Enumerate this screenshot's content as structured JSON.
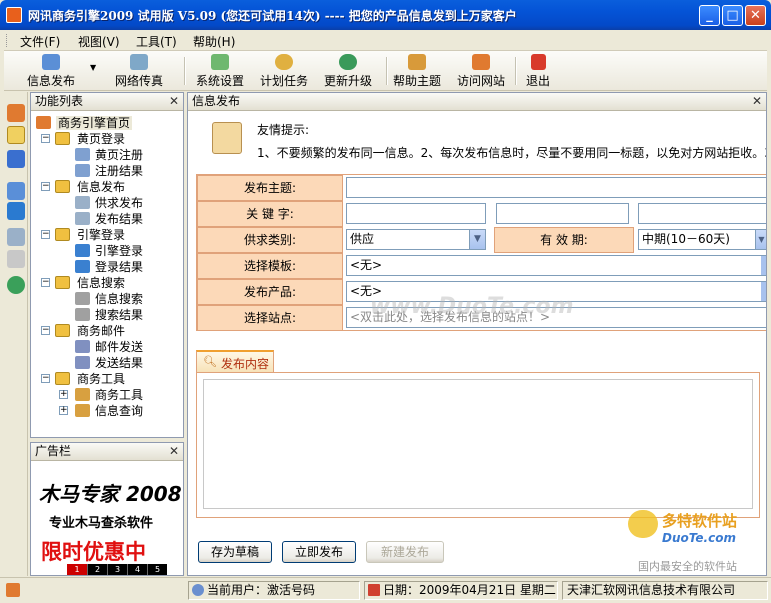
{
  "window": {
    "title": "网讯商务引擎2009 试用版 V5.09 (您还可试用14次) ---- 把您的产品信息发到上万家客户",
    "colors": {
      "titlebar": "#0453d6",
      "form_label_bg": "#fcd9b8",
      "form_border": "#e0a27a",
      "accent": "#e8601c"
    }
  },
  "menu": [
    "文件(F)",
    "视图(V)",
    "工具(T)",
    "帮助(H)"
  ],
  "toolbar": [
    {
      "label": "信息发布",
      "icon": "publish-icon"
    },
    {
      "label": "网络传真",
      "icon": "fax-icon"
    },
    {
      "label": "系统设置",
      "icon": "settings-icon"
    },
    {
      "label": "计划任务",
      "icon": "clock-icon"
    },
    {
      "label": "更新升级",
      "icon": "update-icon"
    },
    {
      "label": "帮助主题",
      "icon": "help-book-icon"
    },
    {
      "label": "访问网站",
      "icon": "home-icon"
    },
    {
      "label": "退出",
      "icon": "exit-icon"
    }
  ],
  "function_panel": {
    "title": "功能列表",
    "root": "商务引擎首页",
    "groups": [
      {
        "label": "黄页登录",
        "items": [
          "黄页注册",
          "注册结果"
        ]
      },
      {
        "label": "信息发布",
        "items": [
          "供求发布",
          "发布结果"
        ]
      },
      {
        "label": "引擎登录",
        "items": [
          "引擎登录",
          "登录结果"
        ]
      },
      {
        "label": "信息搜索",
        "items": [
          "信息搜索",
          "搜索结果"
        ]
      },
      {
        "label": "商务邮件",
        "items": [
          "邮件发送",
          "发送结果"
        ]
      },
      {
        "label": "商务工具",
        "items": [
          "商务工具",
          "信息查询"
        ]
      }
    ]
  },
  "ad_panel": {
    "title": "广告栏",
    "brand": "木马专家 2008",
    "slogan": "专业木马查杀软件",
    "promo": "限时优惠中",
    "pages": [
      "1",
      "2",
      "3",
      "4",
      "5"
    ]
  },
  "main": {
    "title": "信息发布",
    "tip_title": "友情提示:",
    "tip_text": "1、不要频繁的发布同一信息。2、每次发布信息时，尽量不要用同一标题，以免对方网站拒收。3",
    "form": {
      "subject_label": "发布主题:",
      "subject_value": "",
      "keyword_label": "关 键 字:",
      "keywords": [
        "",
        "",
        ""
      ],
      "category_label": "供求类别:",
      "category_value": "供应",
      "validity_label": "有 效 期:",
      "validity_value": "中期(10－60天)",
      "template_label": "选择模板:",
      "template_value": "<无>",
      "product_label": "发布产品:",
      "product_value": "<无>",
      "site_label": "选择站点:",
      "site_placeholder": "<双击此处，选择发布信息的站点！>"
    },
    "content_tab": "发布内容",
    "content_value": "",
    "buttons": {
      "draft": "存为草稿",
      "publish": "立即发布",
      "new": "新建发布"
    }
  },
  "watermark": {
    "center": "www.DuoTe.com",
    "corner_cn": "多特软件站",
    "corner_en": "DuoTe.com",
    "corner_sub": "国内最安全的软件站"
  },
  "statusbar": {
    "user": "当前用户：激活号码",
    "date": "日期：2009年04月21日 星期二",
    "company": "天津汇软网讯信息技术有限公司"
  }
}
